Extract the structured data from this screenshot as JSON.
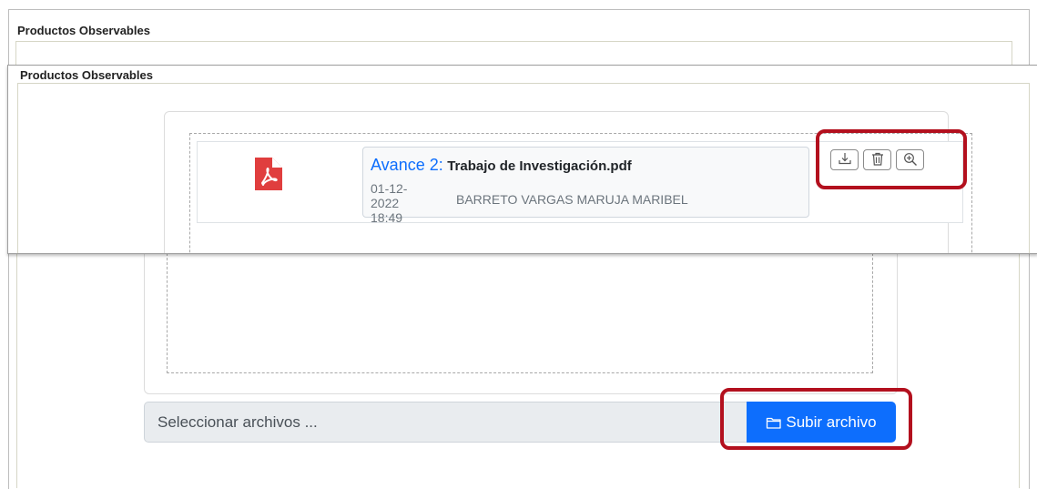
{
  "section_title_back": "Productos Observables",
  "section_title_front": "Productos Observables",
  "file_item": {
    "icon": "pdf-file-icon",
    "stage": "Avance 2:",
    "name": "Trabajo de Investigación.pdf",
    "date": "01-12-2022",
    "time": "18:49",
    "author": "BARRETO VARGAS MARUJA MARIBEL",
    "actions": [
      "download-icon",
      "trash-icon",
      "zoom-in-icon"
    ]
  },
  "upload": {
    "placeholder": "Seleccionar archivos ...",
    "button_label": "Subir archivo",
    "button_icon": "folder-icon"
  },
  "colors": {
    "accent": "#0d6efd",
    "highlight": "#b3101e",
    "pdf": "#e03e3e"
  }
}
